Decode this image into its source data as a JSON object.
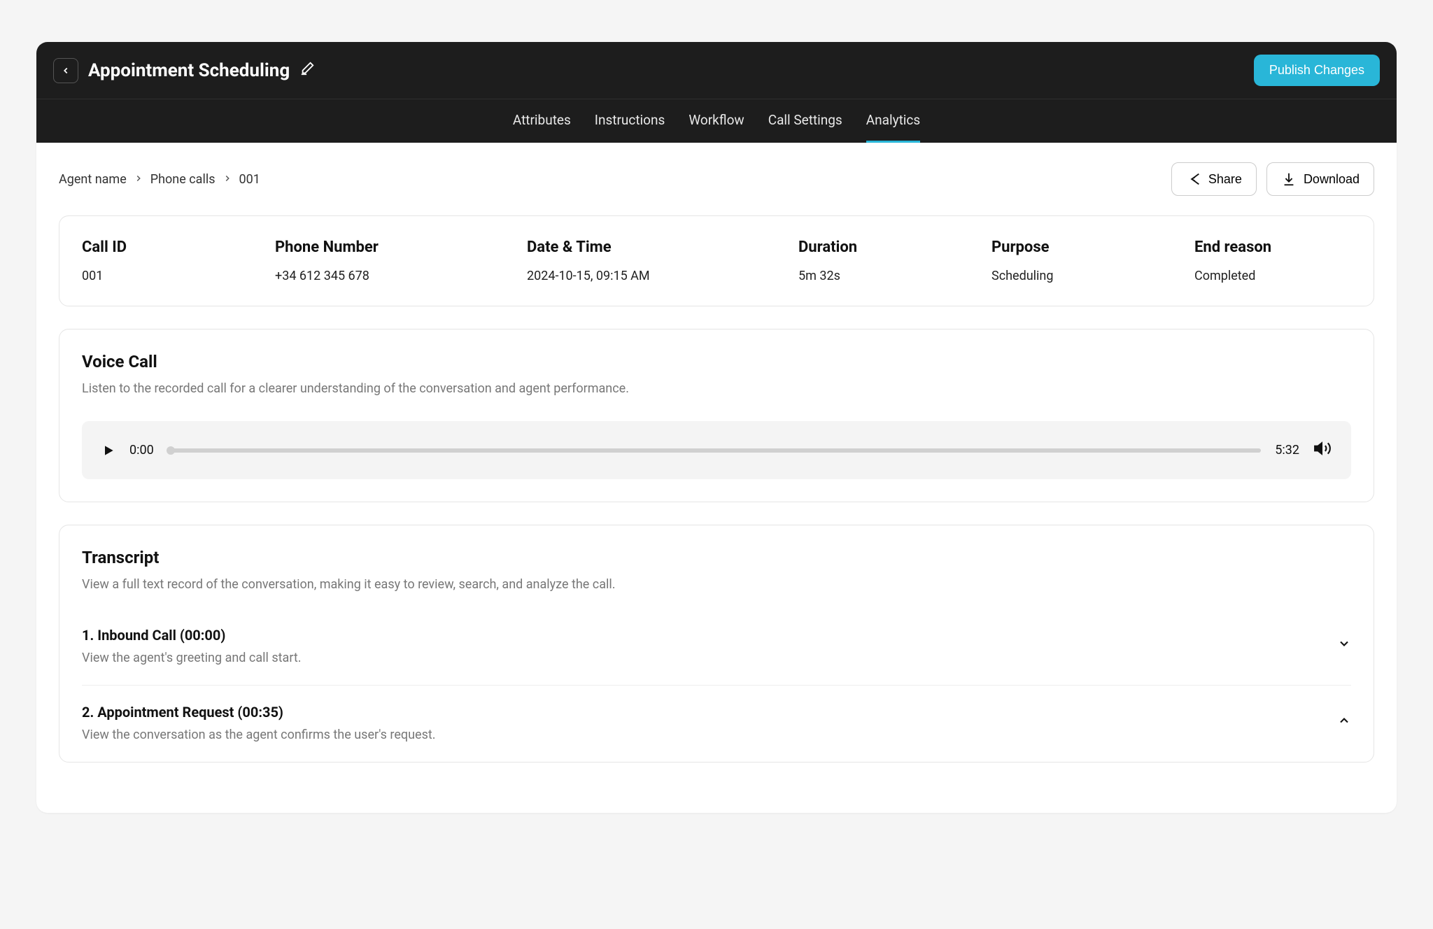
{
  "header": {
    "title": "Appointment Scheduling",
    "publish_label": "Publish Changes"
  },
  "tabs": [
    {
      "label": "Attributes",
      "active": false
    },
    {
      "label": "Instructions",
      "active": false
    },
    {
      "label": "Workflow",
      "active": false
    },
    {
      "label": "Call Settings",
      "active": false
    },
    {
      "label": "Analytics",
      "active": true
    }
  ],
  "breadcrumb": {
    "level1": "Agent name",
    "level2": "Phone calls",
    "level3": "001"
  },
  "actions": {
    "share_label": "Share",
    "download_label": "Download"
  },
  "call_info": {
    "call_id_label": "Call ID",
    "call_id_value": "001",
    "phone_label": "Phone Number",
    "phone_value": "+34 612 345 678",
    "datetime_label": "Date & Time",
    "datetime_value": "2024-10-15, 09:15 AM",
    "duration_label": "Duration",
    "duration_value": "5m 32s",
    "purpose_label": "Purpose",
    "purpose_value": "Scheduling",
    "end_label": "End reason",
    "end_value": "Completed"
  },
  "voice": {
    "title": "Voice Call",
    "desc": "Listen to the recorded call for a clearer understanding of the conversation and agent performance.",
    "current": "0:00",
    "total": "5:32"
  },
  "transcript": {
    "title": "Transcript",
    "desc": "View a full text record of the conversation, making it easy to review, search, and analyze the call.",
    "items": [
      {
        "title": "1. Inbound Call  (00:00)",
        "desc": "View the agent's greeting and call start.",
        "expanded": false
      },
      {
        "title": "2. Appointment Request  (00:35)",
        "desc": "View the conversation as the agent confirms the user's request.",
        "expanded": true
      }
    ]
  }
}
